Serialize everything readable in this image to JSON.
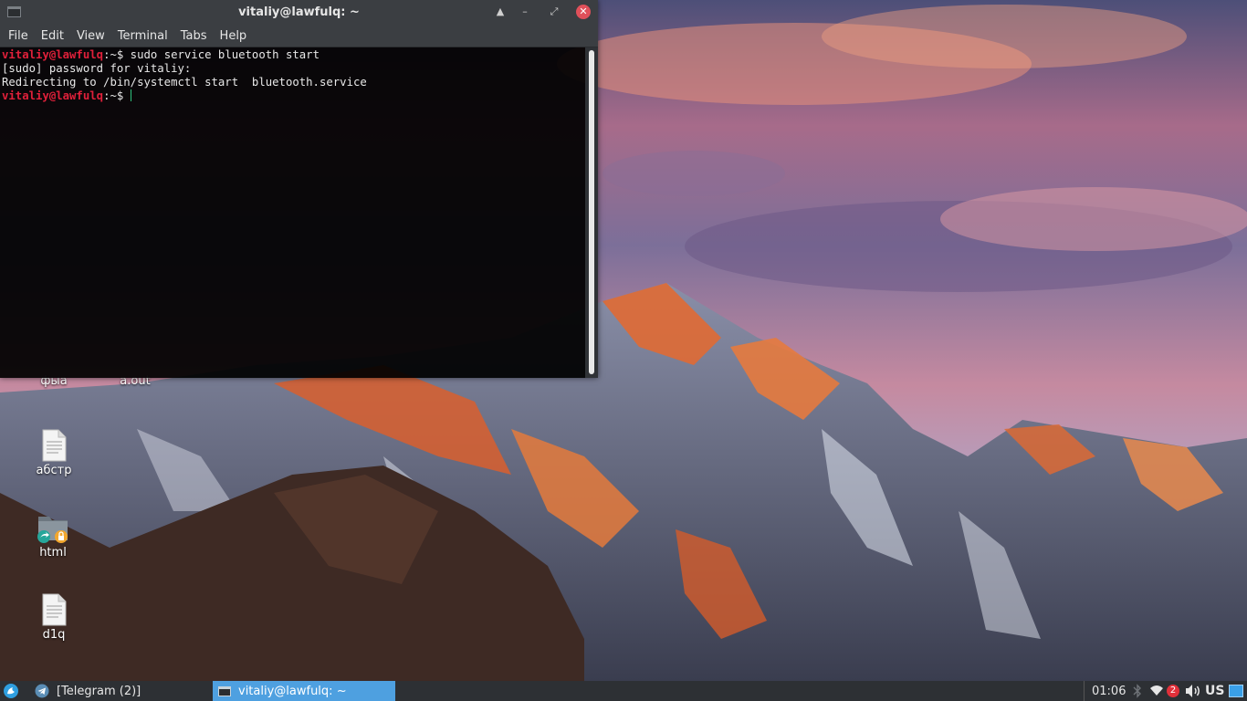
{
  "terminal": {
    "title": "vitaliy@lawfulq: ~",
    "controls": {
      "keep_above": "▲",
      "minimize": "–",
      "maximize": "⤢",
      "close": "✕"
    },
    "menu": [
      "File",
      "Edit",
      "View",
      "Terminal",
      "Tabs",
      "Help"
    ],
    "lines": [
      {
        "user": "vitaliy@lawfulq",
        "rest": ":~$ sudo service bluetooth start"
      },
      {
        "user": "",
        "rest": "[sudo] password for vitaliy:"
      },
      {
        "user": "",
        "rest": "Redirecting to /bin/systemctl start  bluetooth.service"
      },
      {
        "user": "vitaliy@lawfulq",
        "rest": ":~$ "
      }
    ]
  },
  "desktop_icons": [
    {
      "label": "фыа",
      "icon": "folder-icon"
    },
    {
      "label": "a.out",
      "icon": "executable-icon"
    },
    {
      "label": "абстр",
      "icon": "text-file-icon"
    },
    {
      "label": "html",
      "icon": "shared-locked-folder-icon"
    },
    {
      "label": "d1q",
      "icon": "text-file-icon"
    }
  ],
  "taskbar": {
    "tasks": [
      {
        "label": "[Telegram (2)]",
        "icon": "telegram-icon",
        "active": false
      },
      {
        "label": "vitaliy@lawfulq: ~",
        "icon": "terminal-icon",
        "active": true
      }
    ],
    "clock": "01:06",
    "notification_count": "2",
    "keyboard_layout": "US"
  },
  "colors": {
    "prompt_user": "#e0203a",
    "active_task": "#4ea0e0",
    "panel": "#2d3034",
    "close_button": "#e0505a"
  }
}
